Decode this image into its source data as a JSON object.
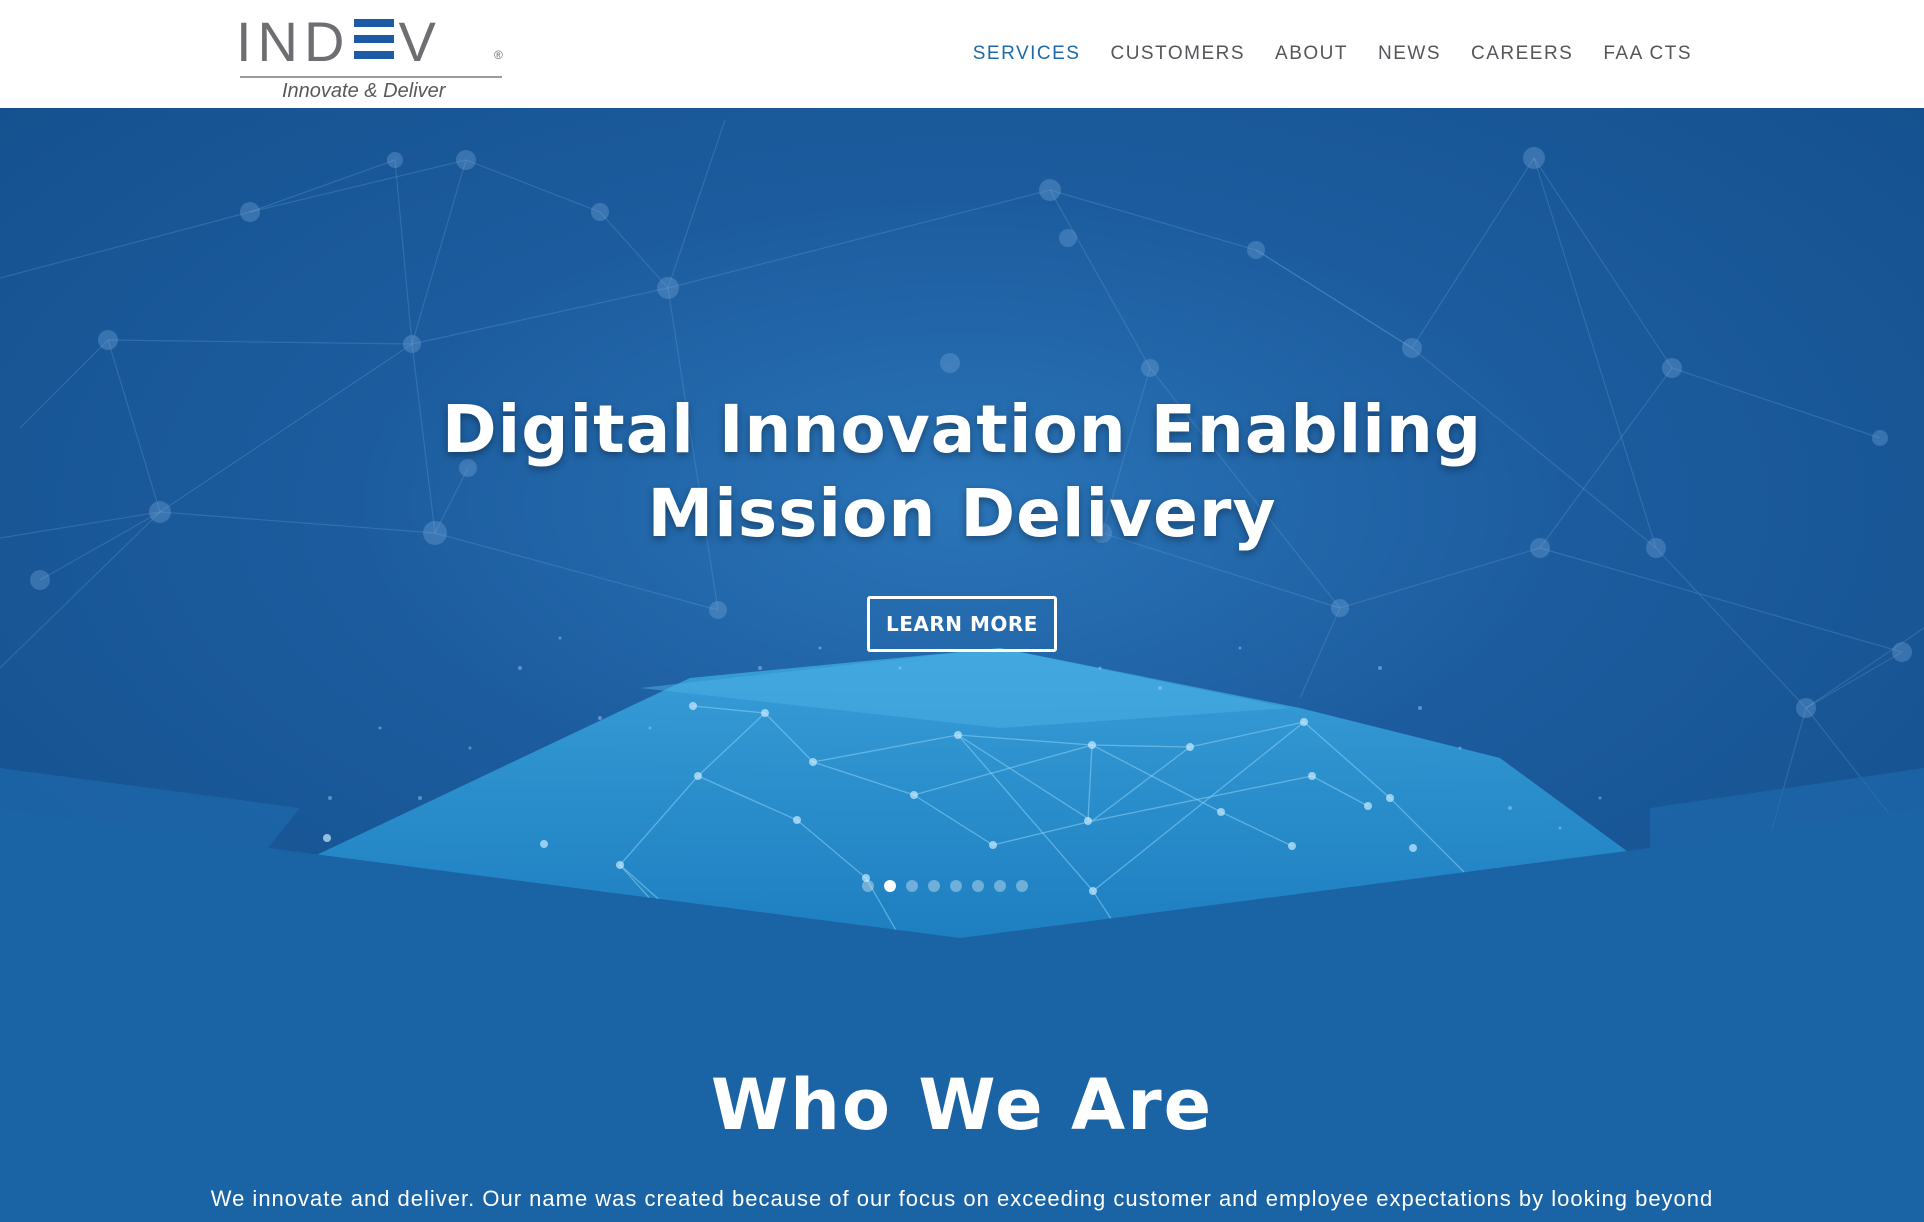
{
  "header": {
    "logo": {
      "word": "INDEV",
      "registered": "®",
      "tagline": "Innovate & Deliver"
    },
    "nav": [
      {
        "label": "SERVICES",
        "active": true
      },
      {
        "label": "CUSTOMERS",
        "active": false
      },
      {
        "label": "ABOUT",
        "active": false
      },
      {
        "label": "NEWS",
        "active": false
      },
      {
        "label": "CAREERS",
        "active": false
      },
      {
        "label": "FAA CTS",
        "active": false
      }
    ]
  },
  "hero": {
    "title_line1": "Digital Innovation Enabling",
    "title_line2": "Mission Delivery",
    "button_label": "LEARN MORE",
    "slides_count": 8,
    "active_slide": 1
  },
  "who": {
    "title": "Who We Are",
    "text": "We innovate and deliver. Our name was created because of our focus on exceeding customer and employee expectations by looking beyond"
  },
  "colors": {
    "accent": "#1e6aa8",
    "hero_bg": "#1c5c9e",
    "section_bg": "#1a64a6",
    "logo_blue": "#1d5aa6",
    "logo_gray": "#6d6e71"
  }
}
